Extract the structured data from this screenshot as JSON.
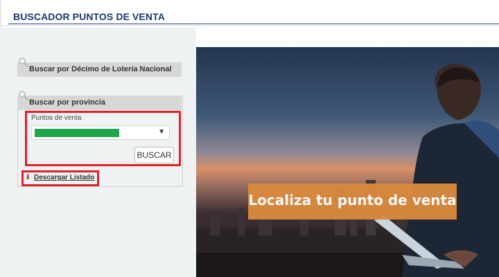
{
  "header": {
    "title": "BUSCADOR PUNTOS DE VENTA"
  },
  "search_decimo": {
    "label": "Buscar por Décimo de Lotería Nacional",
    "icon": "magnifier-icon"
  },
  "search_provincia": {
    "label": "Buscar por provincia",
    "icon": "magnifier-icon",
    "field_label": "Puntos de venta",
    "select_value_color": "#1fa64a",
    "button_label": "BUSCAR"
  },
  "download": {
    "label": "Descargar Listado",
    "icon": "download-arrow-icon"
  },
  "hero": {
    "banner_text": "Localiza tu punto de venta",
    "banner_color": "#d98a3e"
  },
  "colors": {
    "highlight": "#e0202a",
    "title": "#1a3a6b"
  }
}
